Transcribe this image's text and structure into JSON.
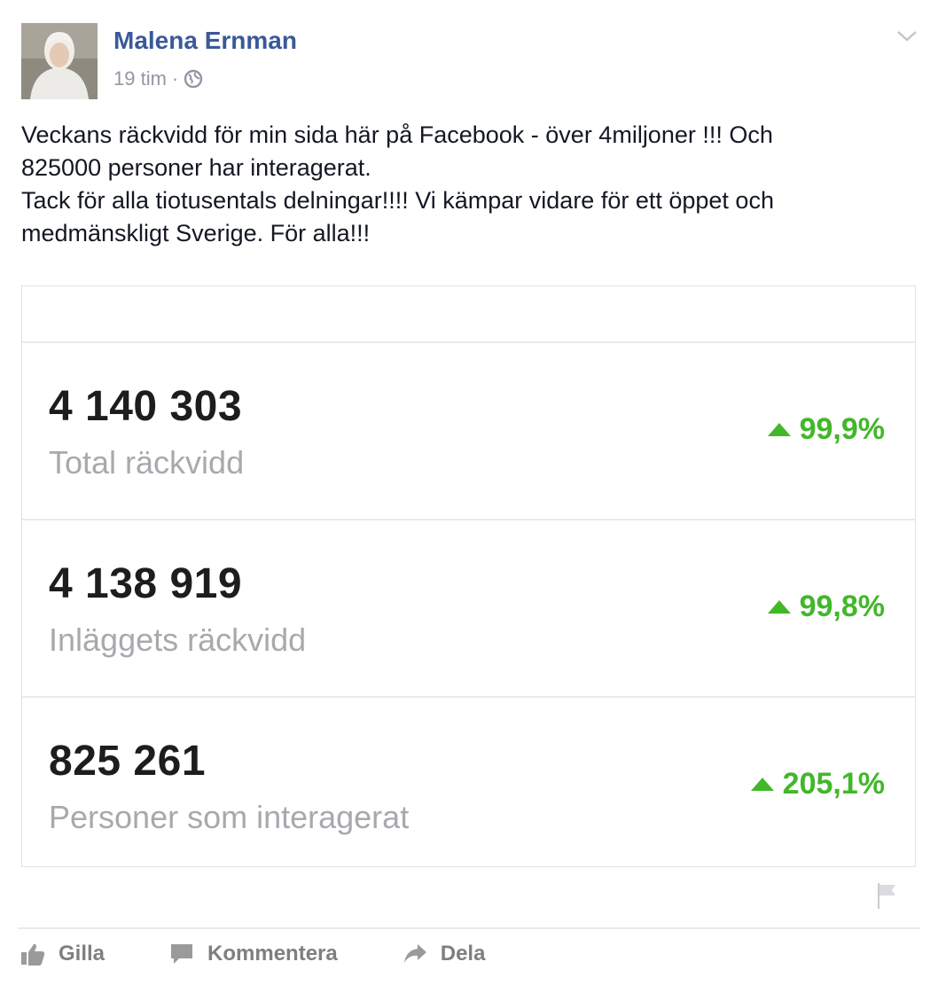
{
  "post": {
    "author": "Malena Ernman",
    "time": "19 tim",
    "separator": "·",
    "text_lines": [
      "Veckans räckvidd för min sida här på Facebook - över 4miljoner !!! Och",
      "825000 personer har interagerat.",
      "Tack för alla tiotusentals delningar!!!! Vi kämpar vidare för ett öppet och",
      "medmänskligt Sverige. För alla!!!"
    ]
  },
  "stats": [
    {
      "value": "4 140 303",
      "label": "Total räckvidd",
      "change": "99,9%"
    },
    {
      "value": "4 138 919",
      "label": "Inläggets räckvidd",
      "change": "99,8%"
    },
    {
      "value": "825 261",
      "label": "Personer som interagerat",
      "change": "205,1%"
    }
  ],
  "actions": {
    "like": "Gilla",
    "comment": "Kommentera",
    "share": "Dela"
  },
  "colors": {
    "author": "#3b5998",
    "positive": "#42b72a",
    "muted": "#9197a3"
  },
  "icons": [
    "globe-icon",
    "chevron-down-icon",
    "flag-icon",
    "like-icon",
    "comment-icon",
    "share-icon",
    "triangle-up-icon"
  ]
}
